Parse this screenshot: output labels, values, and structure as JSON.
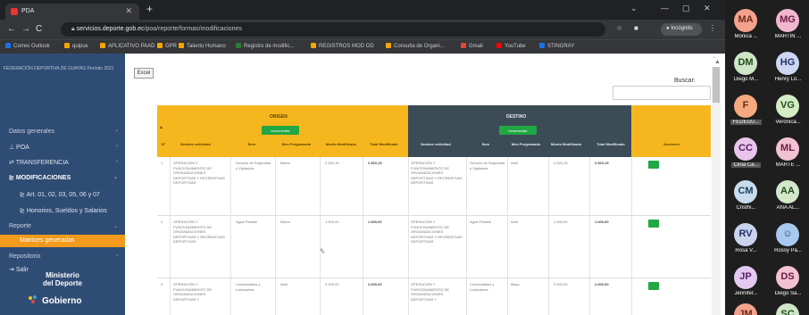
{
  "browser": {
    "tab_title": "PDA",
    "url_host": "servicios.deporte.gob.ec",
    "url_path": "/poa/reporte/formas/modificaciones",
    "profile_label": "Incógnito",
    "bookmarks": [
      {
        "label": "Correo Outlook",
        "color": "#1a73e8"
      },
      {
        "label": "quipux",
        "color": "#f2a600"
      },
      {
        "label": "APLICATIVO PAAD",
        "color": "#f2a600"
      },
      {
        "label": "GPR",
        "color": "#f2a600"
      },
      {
        "label": "Talento Humano",
        "color": "#f2a600"
      },
      {
        "label": "Registro de modific...",
        "color": "#2e7d32"
      },
      {
        "label": "REGISTROS MOD OD",
        "color": "#f2a600"
      },
      {
        "label": "Consulta de Organi...",
        "color": "#f2a600"
      },
      {
        "label": "Gmail",
        "color": "#ea4335"
      },
      {
        "label": "YouTube",
        "color": "#ff0000"
      },
      {
        "label": "STINGRAY",
        "color": "#1a73e8"
      }
    ]
  },
  "sidebar": {
    "org_heading": "FEDERACIÓN DEPORTIVA DE GUAYAS Período 2021",
    "items": [
      {
        "label": "Datos generales",
        "type": "section"
      },
      {
        "label": "POA",
        "type": "item",
        "icon": "chart-icon"
      },
      {
        "label": "TRANSFERENCIA",
        "type": "item",
        "icon": "transfer-icon"
      },
      {
        "label": "MODIFICACIONES",
        "type": "item",
        "icon": "chart-icon"
      },
      {
        "label": "Art. 01, 02, 03, 05, 06 y 07",
        "type": "sub",
        "icon": "chart-icon"
      },
      {
        "label": "Honorios, Sueldos y Salarios",
        "type": "sub",
        "icon": "chart-icon"
      },
      {
        "label": "Reporte",
        "type": "section"
      },
      {
        "label": "Matrices generadas",
        "type": "active"
      },
      {
        "label": "Repositorio",
        "type": "section"
      },
      {
        "label": "Salir",
        "type": "item",
        "icon": "exit-icon"
      }
    ],
    "logo_line1": "Ministerio",
    "logo_line2": "del Deporte",
    "gov_logo": "Gobierno"
  },
  "main": {
    "excel_label": "Excel",
    "search_label": "Buscar:",
    "group_left_title": "ORIGEN",
    "group_right_title": "DESTINO",
    "add_button_label": "Incrementar",
    "columns_left": [
      "N°",
      "Nombre actividad",
      "Ítem",
      "Mes Programado",
      "Monto Modificado",
      "Total Modificado"
    ],
    "columns_right": [
      "Nombre actividad",
      "Ítem",
      "Mes Programado",
      "Monto Modificado",
      "Total Modificado",
      "Acciones"
    ],
    "rows": [
      {
        "n": "1",
        "activity": "OPERACIÓN Y FUNCIONAMIENTO DE ORGANIZACIONES DEPORTIVAS Y RECREATIVAS DEPORTIVAS",
        "item": "Servicio de Seguridad y Vigilancia",
        "month": "Marzo",
        "amount": "2.520,15",
        "total": "2.520,15",
        "dest_activity": "OPERACIÓN Y FUNCIONAMIENTO DE ORGANIZACIONES DEPORTIVAS Y RECREATIVAS DEPORTIVAS",
        "dest_item": "Servicio de Seguridad y Vigilancia",
        "dest_month": "Abril",
        "dest_amount": "2.520,15",
        "dest_total": "2.520,15"
      },
      {
        "n": "2",
        "activity": "OPERACIÓN Y FUNCIONAMIENTO DE ORGANIZACIONES DEPORTIVAS Y RECREATIVAS DEPORTIVAS",
        "item": "Agua Potable",
        "month": "Marzo",
        "amount": "1.000,00",
        "total": "1.000,00",
        "dest_activity": "OPERACIÓN Y FUNCIONAMIENTO DE ORGANIZACIONES DEPORTIVAS Y RECREATIVAS DEPORTIVAS",
        "dest_item": "Agua Potable",
        "dest_month": "Abril",
        "dest_amount": "1.000,00",
        "dest_total": "1.000,00"
      },
      {
        "n": "3",
        "activity": "OPERACIÓN Y FUNCIONAMIENTO DE ORGANIZACIONES DEPORTIVAS Y",
        "item": "Combustibles y Lubricantes",
        "month": "Abril",
        "amount": "2.000,00",
        "total": "2.000,00",
        "dest_activity": "OPERACIÓN Y FUNCIONAMIENTO DE ORGANIZACIONES DEPORTIVAS Y",
        "dest_item": "Combustibles y Lubricantes",
        "dest_month": "Mayo",
        "dest_amount": "2.000,00",
        "dest_total": "2.000,00"
      }
    ]
  },
  "participants": [
    {
      "initials": "MA",
      "name": "Mónica ...",
      "color": "#f4a28c"
    },
    {
      "initials": "MG",
      "name": "MARTIN ...",
      "color": "#f0b6cf"
    },
    {
      "initials": "DM",
      "name": "Diego M...",
      "color": "#cfe6c9"
    },
    {
      "initials": "HG",
      "name": "Henry Lo...",
      "color": "#cdd6f2"
    },
    {
      "initials": "F",
      "name": "FEDEGU...",
      "color": "#f6a880",
      "highlight": true
    },
    {
      "initials": "VG",
      "name": "Verónica...",
      "color": "#d3ecc4"
    },
    {
      "initials": "CC",
      "name": "Cinia Ca...",
      "color": "#e7c4ea",
      "highlight": true
    },
    {
      "initials": "ML",
      "name": "MARTE ...",
      "color": "#f2c1d4"
    },
    {
      "initials": "CM",
      "name": "Cristhi...",
      "color": "#c9dcee"
    },
    {
      "initials": "AA",
      "name": "ANA AL...",
      "color": "#d2e8c9"
    },
    {
      "initials": "RV",
      "name": "Rosa V...",
      "color": "#c9d4ec"
    },
    {
      "initials": "☺",
      "name": "Rossy Pa...",
      "color": "#a8c9ef"
    },
    {
      "initials": "JP",
      "name": "Jennifer...",
      "color": "#e3c9ef"
    },
    {
      "initials": "DS",
      "name": "Diego Sa...",
      "color": "#f3c1d2"
    },
    {
      "initials": "JM",
      "name": "",
      "color": "#f4a28c"
    },
    {
      "initials": "SC",
      "name": "",
      "color": "#cfe6c9"
    }
  ]
}
